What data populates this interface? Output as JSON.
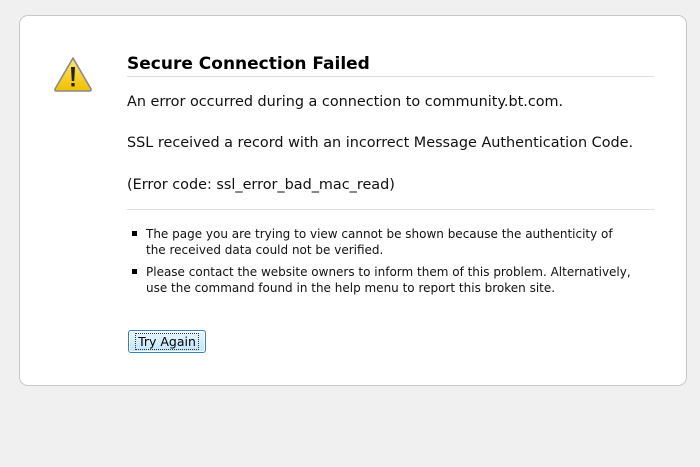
{
  "error": {
    "title": "Secure Connection Failed",
    "message_1": "An error occurred during a connection to community.bt.com.",
    "message_2": "SSL received a record with an incorrect Message Authentication Code.",
    "message_3": "(Error code: ssl_error_bad_mac_read)",
    "icon": "warning-icon",
    "bullets": [
      "The page you are trying to view cannot be shown because the authenticity of the received data could not be verified.",
      "Please contact the website owners to inform them of this problem. Alternatively, use the command found in the help menu to report this broken site."
    ],
    "try_again_label": "Try Again"
  },
  "colors": {
    "background": "#f0f0f0",
    "box": "#ffffff",
    "warning_fill": "#f5d21a",
    "button_border": "#3c7fb1"
  }
}
